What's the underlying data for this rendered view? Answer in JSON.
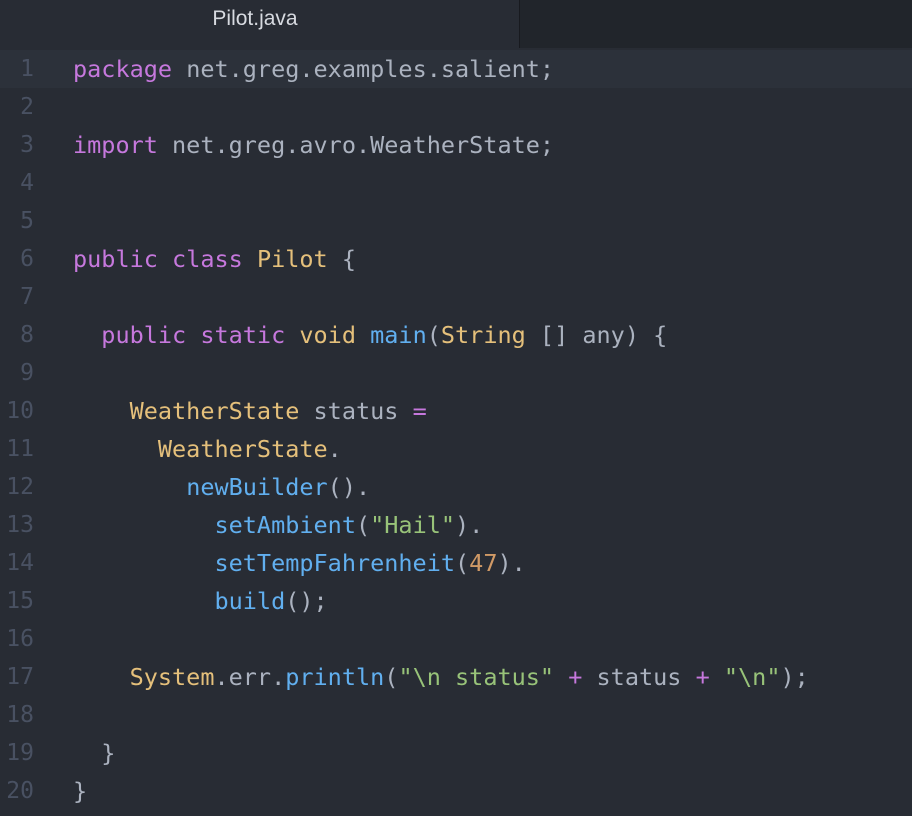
{
  "tab": {
    "title": "Pilot.java"
  },
  "colors": {
    "background": "#282c34",
    "keyword": "#c678dd",
    "type": "#e5c07b",
    "function": "#61afef",
    "string": "#98c379",
    "number": "#d19a66",
    "plain": "#abb2bf",
    "gutter": "#495162"
  },
  "lines": [
    {
      "num": "1",
      "active": true,
      "tokens": [
        {
          "t": "package",
          "c": "kw"
        },
        {
          "t": " net.greg.examples.salient;",
          "c": "pl"
        }
      ]
    },
    {
      "num": "2",
      "active": false,
      "tokens": []
    },
    {
      "num": "3",
      "active": false,
      "tokens": [
        {
          "t": "import",
          "c": "kw"
        },
        {
          "t": " net.greg.avro.WeatherState;",
          "c": "pl"
        }
      ]
    },
    {
      "num": "4",
      "active": false,
      "tokens": []
    },
    {
      "num": "5",
      "active": false,
      "tokens": []
    },
    {
      "num": "6",
      "active": false,
      "tokens": [
        {
          "t": "public",
          "c": "kw"
        },
        {
          "t": " ",
          "c": "pl"
        },
        {
          "t": "class",
          "c": "kw"
        },
        {
          "t": " ",
          "c": "pl"
        },
        {
          "t": "Pilot",
          "c": "ty"
        },
        {
          "t": " {",
          "c": "pl"
        }
      ]
    },
    {
      "num": "7",
      "active": false,
      "tokens": []
    },
    {
      "num": "8",
      "active": false,
      "tokens": [
        {
          "t": "  ",
          "c": "pl"
        },
        {
          "t": "public",
          "c": "kw"
        },
        {
          "t": " ",
          "c": "pl"
        },
        {
          "t": "static",
          "c": "kw"
        },
        {
          "t": " ",
          "c": "pl"
        },
        {
          "t": "void",
          "c": "ty"
        },
        {
          "t": " ",
          "c": "pl"
        },
        {
          "t": "main",
          "c": "fn"
        },
        {
          "t": "(",
          "c": "pl"
        },
        {
          "t": "String",
          "c": "ty"
        },
        {
          "t": " [] any) {",
          "c": "pl"
        }
      ]
    },
    {
      "num": "9",
      "active": false,
      "tokens": []
    },
    {
      "num": "10",
      "active": false,
      "tokens": [
        {
          "t": "    ",
          "c": "pl"
        },
        {
          "t": "WeatherState",
          "c": "ty"
        },
        {
          "t": " status ",
          "c": "pl"
        },
        {
          "t": "=",
          "c": "op"
        }
      ]
    },
    {
      "num": "11",
      "active": false,
      "tokens": [
        {
          "t": "      ",
          "c": "pl"
        },
        {
          "t": "WeatherState",
          "c": "ty"
        },
        {
          "t": ".",
          "c": "pl"
        }
      ]
    },
    {
      "num": "12",
      "active": false,
      "tokens": [
        {
          "t": "        ",
          "c": "pl"
        },
        {
          "t": "newBuilder",
          "c": "fn"
        },
        {
          "t": "().",
          "c": "pl"
        }
      ]
    },
    {
      "num": "13",
      "active": false,
      "tokens": [
        {
          "t": "          ",
          "c": "pl"
        },
        {
          "t": "setAmbient",
          "c": "fn"
        },
        {
          "t": "(",
          "c": "pl"
        },
        {
          "t": "\"Hail\"",
          "c": "st"
        },
        {
          "t": ").",
          "c": "pl"
        }
      ]
    },
    {
      "num": "14",
      "active": false,
      "tokens": [
        {
          "t": "          ",
          "c": "pl"
        },
        {
          "t": "setTempFahrenheit",
          "c": "fn"
        },
        {
          "t": "(",
          "c": "pl"
        },
        {
          "t": "47",
          "c": "nu"
        },
        {
          "t": ").",
          "c": "pl"
        }
      ]
    },
    {
      "num": "15",
      "active": false,
      "tokens": [
        {
          "t": "          ",
          "c": "pl"
        },
        {
          "t": "build",
          "c": "fn"
        },
        {
          "t": "();",
          "c": "pl"
        }
      ]
    },
    {
      "num": "16",
      "active": false,
      "tokens": []
    },
    {
      "num": "17",
      "active": false,
      "tokens": [
        {
          "t": "    ",
          "c": "pl"
        },
        {
          "t": "System",
          "c": "ty"
        },
        {
          "t": ".err.",
          "c": "pl"
        },
        {
          "t": "println",
          "c": "fn"
        },
        {
          "t": "(",
          "c": "pl"
        },
        {
          "t": "\"\\n status\"",
          "c": "st"
        },
        {
          "t": " ",
          "c": "pl"
        },
        {
          "t": "+",
          "c": "op"
        },
        {
          "t": " status ",
          "c": "pl"
        },
        {
          "t": "+",
          "c": "op"
        },
        {
          "t": " ",
          "c": "pl"
        },
        {
          "t": "\"\\n\"",
          "c": "st"
        },
        {
          "t": ");",
          "c": "pl"
        }
      ]
    },
    {
      "num": "18",
      "active": false,
      "tokens": []
    },
    {
      "num": "19",
      "active": false,
      "tokens": [
        {
          "t": "  }",
          "c": "pl"
        }
      ]
    },
    {
      "num": "20",
      "active": false,
      "tokens": [
        {
          "t": "}",
          "c": "pl"
        }
      ]
    }
  ]
}
